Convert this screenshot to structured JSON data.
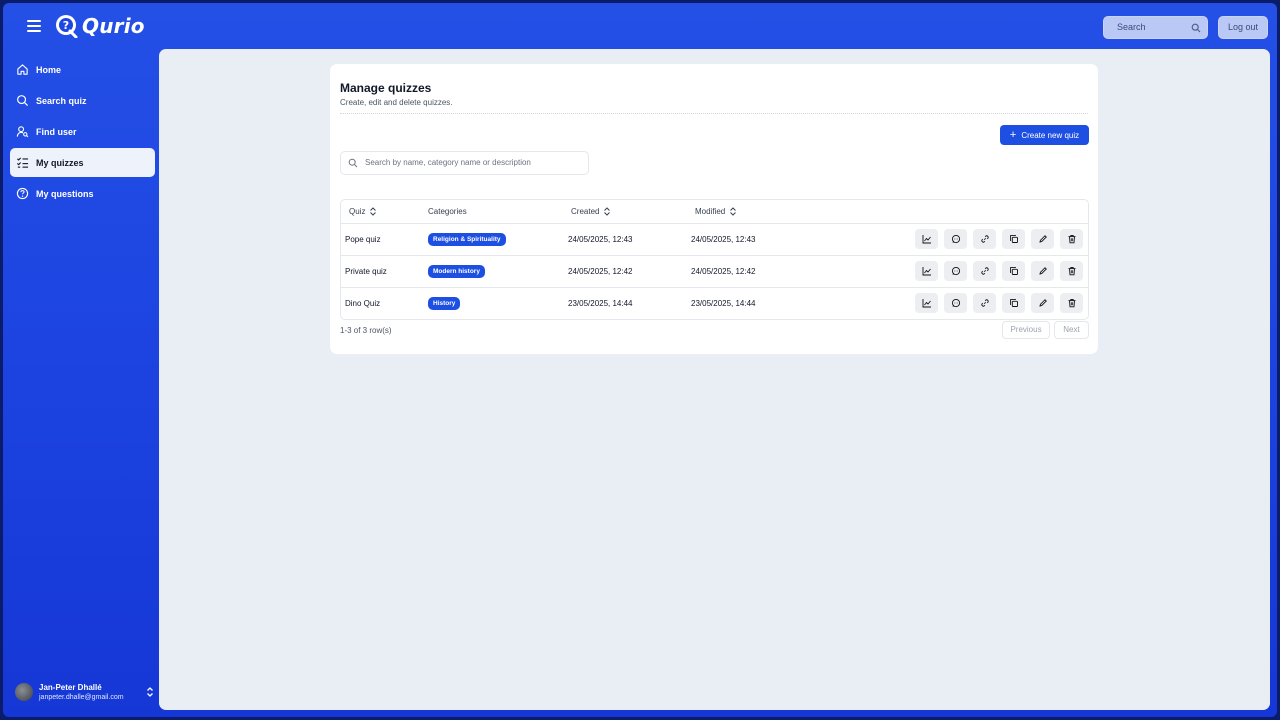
{
  "app": {
    "name": "Qurio"
  },
  "topbar": {
    "search_placeholder": "Search",
    "logout_label": "Log out"
  },
  "sidebar": {
    "items": [
      {
        "label": "Home",
        "icon": "home-icon"
      },
      {
        "label": "Search quiz",
        "icon": "search-icon"
      },
      {
        "label": "Find user",
        "icon": "user-search-icon"
      },
      {
        "label": "My quizzes",
        "icon": "list-check-icon",
        "active": true
      },
      {
        "label": "My questions",
        "icon": "question-circle-icon"
      }
    ],
    "user": {
      "name": "Jan-Peter Dhallé",
      "email": "janpeter.dhalle@gmail.com"
    }
  },
  "page": {
    "title": "Manage quizzes",
    "subtitle": "Create, edit and delete quizzes.",
    "create_button": "Create new quiz",
    "search_placeholder": "Search by name, category name or description"
  },
  "table": {
    "headers": {
      "quiz": "Quiz",
      "categories": "Categories",
      "created": "Created",
      "modified": "Modified"
    },
    "rows": [
      {
        "quiz": "Pope quiz",
        "category": "Religion & Spirituality",
        "created": "24/05/2025, 12:43",
        "modified": "24/05/2025, 12:43"
      },
      {
        "quiz": "Private quiz",
        "category": "Modern history",
        "created": "24/05/2025, 12:42",
        "modified": "24/05/2025, 12:42"
      },
      {
        "quiz": "Dino Quiz",
        "category": "History",
        "created": "23/05/2025, 14:44",
        "modified": "23/05/2025, 14:44"
      }
    ],
    "row_actions": [
      "chart-icon",
      "comment-icon",
      "link-icon",
      "copy-icon",
      "edit-icon",
      "delete-icon"
    ],
    "footer": {
      "count": "1-3 of 3 row(s)",
      "previous": "Previous",
      "next": "Next"
    }
  },
  "colors": {
    "primary": "#1e4fe3",
    "sidebar_bg": "#1e46e2",
    "content_bg": "#e9edf4"
  }
}
